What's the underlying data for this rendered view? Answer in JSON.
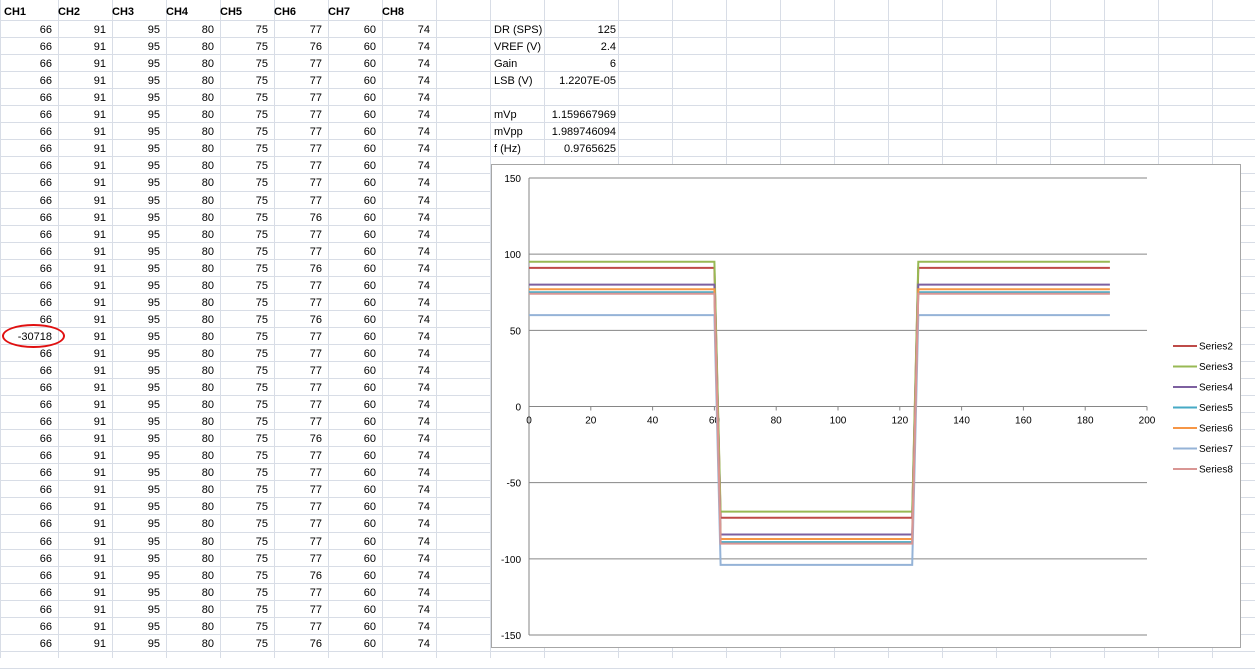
{
  "headers": [
    "CH1",
    "CH2",
    "CH3",
    "CH4",
    "CH5",
    "CH6",
    "CH7",
    "CH8"
  ],
  "rows": [
    [
      "66",
      "91",
      "95",
      "80",
      "75",
      "77",
      "60",
      "74"
    ],
    [
      "66",
      "91",
      "95",
      "80",
      "75",
      "76",
      "60",
      "74"
    ],
    [
      "66",
      "91",
      "95",
      "80",
      "75",
      "77",
      "60",
      "74"
    ],
    [
      "66",
      "91",
      "95",
      "80",
      "75",
      "77",
      "60",
      "74"
    ],
    [
      "66",
      "91",
      "95",
      "80",
      "75",
      "77",
      "60",
      "74"
    ],
    [
      "66",
      "91",
      "95",
      "80",
      "75",
      "77",
      "60",
      "74"
    ],
    [
      "66",
      "91",
      "95",
      "80",
      "75",
      "77",
      "60",
      "74"
    ],
    [
      "66",
      "91",
      "95",
      "80",
      "75",
      "77",
      "60",
      "74"
    ],
    [
      "66",
      "91",
      "95",
      "80",
      "75",
      "77",
      "60",
      "74"
    ],
    [
      "66",
      "91",
      "95",
      "80",
      "75",
      "77",
      "60",
      "74"
    ],
    [
      "66",
      "91",
      "95",
      "80",
      "75",
      "77",
      "60",
      "74"
    ],
    [
      "66",
      "91",
      "95",
      "80",
      "75",
      "76",
      "60",
      "74"
    ],
    [
      "66",
      "91",
      "95",
      "80",
      "75",
      "77",
      "60",
      "74"
    ],
    [
      "66",
      "91",
      "95",
      "80",
      "75",
      "77",
      "60",
      "74"
    ],
    [
      "66",
      "91",
      "95",
      "80",
      "75",
      "76",
      "60",
      "74"
    ],
    [
      "66",
      "91",
      "95",
      "80",
      "75",
      "77",
      "60",
      "74"
    ],
    [
      "66",
      "91",
      "95",
      "80",
      "75",
      "77",
      "60",
      "74"
    ],
    [
      "66",
      "91",
      "95",
      "80",
      "75",
      "76",
      "60",
      "74"
    ],
    [
      "-30718",
      "91",
      "95",
      "80",
      "75",
      "77",
      "60",
      "74"
    ],
    [
      "66",
      "91",
      "95",
      "80",
      "75",
      "77",
      "60",
      "74"
    ],
    [
      "66",
      "91",
      "95",
      "80",
      "75",
      "77",
      "60",
      "74"
    ],
    [
      "66",
      "91",
      "95",
      "80",
      "75",
      "77",
      "60",
      "74"
    ],
    [
      "66",
      "91",
      "95",
      "80",
      "75",
      "77",
      "60",
      "74"
    ],
    [
      "66",
      "91",
      "95",
      "80",
      "75",
      "77",
      "60",
      "74"
    ],
    [
      "66",
      "91",
      "95",
      "80",
      "75",
      "76",
      "60",
      "74"
    ],
    [
      "66",
      "91",
      "95",
      "80",
      "75",
      "77",
      "60",
      "74"
    ],
    [
      "66",
      "91",
      "95",
      "80",
      "75",
      "77",
      "60",
      "74"
    ],
    [
      "66",
      "91",
      "95",
      "80",
      "75",
      "77",
      "60",
      "74"
    ],
    [
      "66",
      "91",
      "95",
      "80",
      "75",
      "77",
      "60",
      "74"
    ],
    [
      "66",
      "91",
      "95",
      "80",
      "75",
      "77",
      "60",
      "74"
    ],
    [
      "66",
      "91",
      "95",
      "80",
      "75",
      "77",
      "60",
      "74"
    ],
    [
      "66",
      "91",
      "95",
      "80",
      "75",
      "77",
      "60",
      "74"
    ],
    [
      "66",
      "91",
      "95",
      "80",
      "75",
      "76",
      "60",
      "74"
    ],
    [
      "66",
      "91",
      "95",
      "80",
      "75",
      "77",
      "60",
      "74"
    ],
    [
      "66",
      "91",
      "95",
      "80",
      "75",
      "77",
      "60",
      "74"
    ],
    [
      "66",
      "91",
      "95",
      "80",
      "75",
      "77",
      "60",
      "74"
    ],
    [
      "66",
      "91",
      "95",
      "80",
      "75",
      "76",
      "60",
      "74"
    ]
  ],
  "params": [
    {
      "label": "DR (SPS)",
      "value": "125"
    },
    {
      "label": "VREF (V)",
      "value": "2.4"
    },
    {
      "label": "Gain",
      "value": "6"
    },
    {
      "label": "LSB (V)",
      "value": "1.2207E-05"
    },
    {
      "label": "",
      "value": ""
    },
    {
      "label": "mVp",
      "value": "1.159667969"
    },
    {
      "label": "mVpp",
      "value": "1.989746094"
    },
    {
      "label": "f (Hz)",
      "value": "0.9765625"
    }
  ],
  "chart_data": {
    "type": "line",
    "xlim": [
      0,
      200
    ],
    "ylim": [
      -150,
      150
    ],
    "xticks": [
      0,
      20,
      40,
      60,
      80,
      100,
      120,
      140,
      160,
      180,
      200
    ],
    "yticks": [
      150,
      100,
      50,
      0,
      -50,
      -100,
      -150
    ],
    "legend_position": "right",
    "grid": "horizontal",
    "series": [
      {
        "name": "Series2",
        "color": "#be4b48",
        "high": 91,
        "low": -73
      },
      {
        "name": "Series3",
        "color": "#98b954",
        "high": 95,
        "low": -69
      },
      {
        "name": "Series4",
        "color": "#7d60a0",
        "high": 80,
        "low": -84
      },
      {
        "name": "Series5",
        "color": "#46aac5",
        "high": 75,
        "low": -89
      },
      {
        "name": "Series6",
        "color": "#f69646",
        "high": 77,
        "low": -87
      },
      {
        "name": "Series7",
        "color": "#95b3d7",
        "high": 60,
        "low": -104
      },
      {
        "name": "Series8",
        "color": "#d99694",
        "high": 74,
        "low": -90
      }
    ],
    "x_end": 188,
    "fall_x": [
      60,
      62
    ],
    "rise_x": [
      124,
      126
    ]
  }
}
